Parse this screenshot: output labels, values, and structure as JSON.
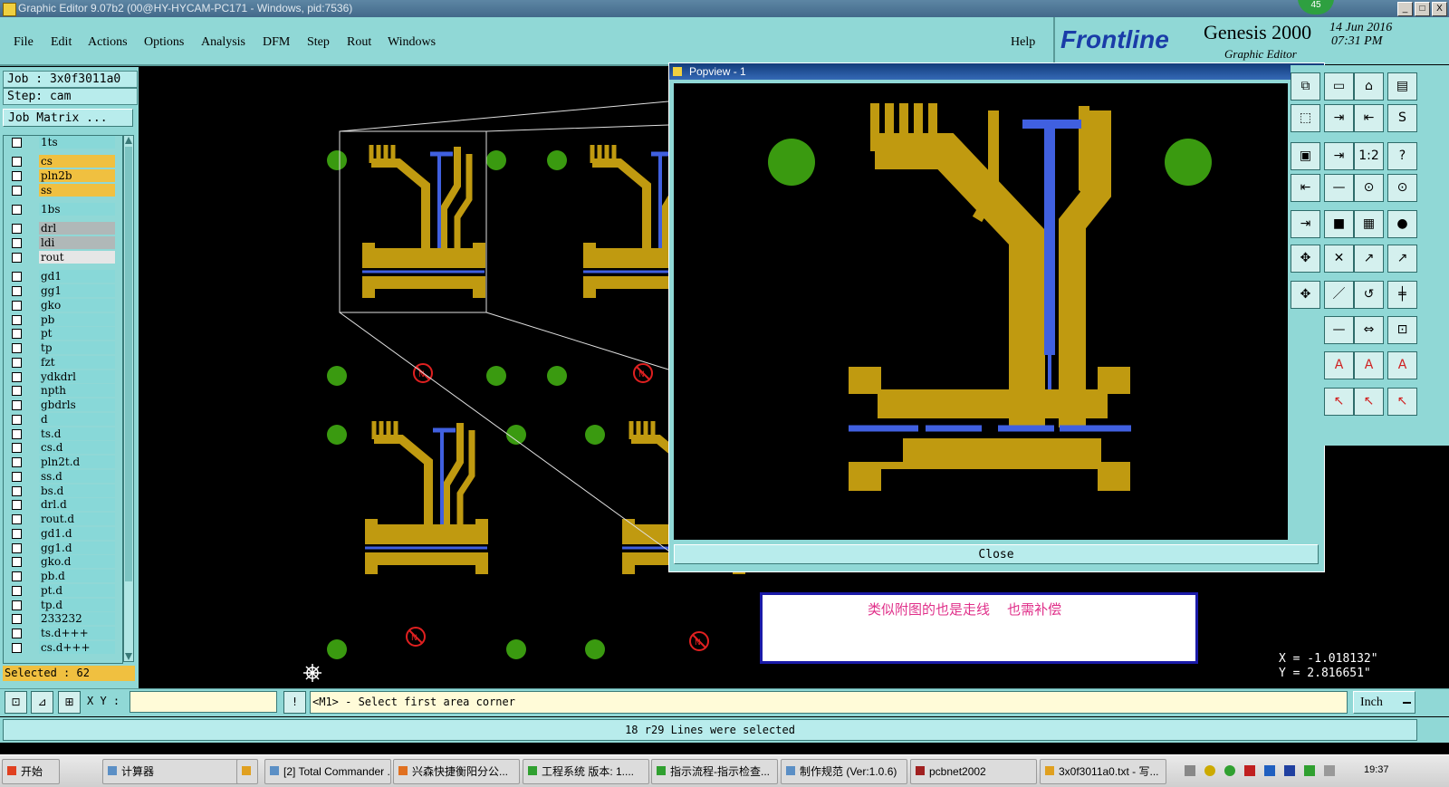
{
  "window": {
    "title": "Graphic Editor 9.07b2 (00@HY-HYCAM-PC171 - Windows, pid:7536)",
    "badge": "45",
    "minimize": "_",
    "restore": "□",
    "close": "X"
  },
  "menu": {
    "items": [
      "File",
      "Edit",
      "Actions",
      "Options",
      "Analysis",
      "DFM",
      "Step",
      "Rout",
      "Windows"
    ],
    "help": "Help"
  },
  "brand": {
    "logo": "Frontline",
    "product": "Genesis 2000",
    "subtitle": "Graphic Editor",
    "date": "14 Jun 2016",
    "time": "07:31 PM"
  },
  "job": {
    "job_label": "Job : 3x0f3011a0",
    "step_label": "Step: cam",
    "matrix_button": "Job Matrix ..."
  },
  "layers": [
    {
      "name": "1ts",
      "state": "normal"
    },
    {
      "name": "cs",
      "state": "sel"
    },
    {
      "name": "pln2b",
      "state": "sel"
    },
    {
      "name": "ss",
      "state": "sel"
    },
    {
      "name": "1bs",
      "state": "normal"
    },
    {
      "name": "drl",
      "state": "gray"
    },
    {
      "name": "ldi",
      "state": "gray"
    },
    {
      "name": "rout",
      "state": "white"
    },
    {
      "name": "gd1",
      "state": "normal"
    },
    {
      "name": "gg1",
      "state": "normal"
    },
    {
      "name": "gko",
      "state": "normal"
    },
    {
      "name": "pb",
      "state": "normal"
    },
    {
      "name": "pt",
      "state": "normal"
    },
    {
      "name": "tp",
      "state": "normal"
    },
    {
      "name": "fzt",
      "state": "normal"
    },
    {
      "name": "ydkdrl",
      "state": "normal"
    },
    {
      "name": "npth",
      "state": "normal"
    },
    {
      "name": "gbdrls",
      "state": "normal"
    },
    {
      "name": "d",
      "state": "normal"
    },
    {
      "name": "ts.d",
      "state": "normal"
    },
    {
      "name": "cs.d",
      "state": "normal"
    },
    {
      "name": "pln2t.d",
      "state": "normal"
    },
    {
      "name": "ss.d",
      "state": "normal"
    },
    {
      "name": "bs.d",
      "state": "normal"
    },
    {
      "name": "drl.d",
      "state": "normal"
    },
    {
      "name": "rout.d",
      "state": "normal"
    },
    {
      "name": "gd1.d",
      "state": "normal"
    },
    {
      "name": "gg1.d",
      "state": "normal"
    },
    {
      "name": "gko.d",
      "state": "normal"
    },
    {
      "name": "pb.d",
      "state": "normal"
    },
    {
      "name": "pt.d",
      "state": "normal"
    },
    {
      "name": "tp.d",
      "state": "normal"
    },
    {
      "name": "233232",
      "state": "normal"
    },
    {
      "name": "ts.d+++",
      "state": "normal"
    },
    {
      "name": "cs.d+++",
      "state": "normal"
    }
  ],
  "selected": "Selected : 62",
  "popview": {
    "title": "Popview - 1",
    "close_button": "Close",
    "close_x": "✕"
  },
  "annotation": {
    "text": "类似附图的也是走线    也需补偿"
  },
  "tools": {
    "ratio_label": "1:2",
    "help_label": "?"
  },
  "coords": {
    "x": "X = -1.018132\"",
    "y": "Y = 2.816651\""
  },
  "bottom": {
    "xy_label": "X Y :",
    "xy_value": "",
    "excl": "!",
    "prompt": "<M1> - Select first area corner",
    "unit": "Inch"
  },
  "status": "18 r29 Lines were selected",
  "taskbar": {
    "start": "开始",
    "items": [
      "计算器",
      "[2] Total Commander ...",
      "兴森快捷衡阳分公...",
      "工程系统  版本: 1....",
      "指示流程-指示检查...",
      "制作规范 (Ver:1.0.6)",
      "pcbnet2002",
      "3x0f3011a0.txt - 写..."
    ],
    "clock": "19:37"
  },
  "colors": {
    "panel": "#90d8d6",
    "copper": "#c09a10",
    "trace_blue": "#4060e0",
    "pad_green": "#3a9a10",
    "annotation_red": "#e0308a"
  }
}
